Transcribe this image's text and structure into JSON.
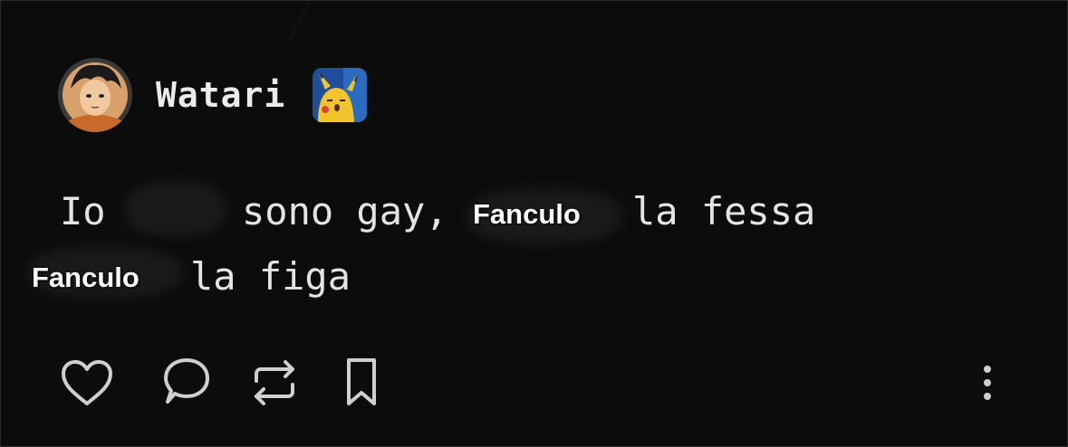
{
  "post": {
    "author": "Watari",
    "text_line1_a": "Io",
    "text_line1_b": "sono gay,",
    "text_line1_c": "la fessa",
    "text_line2": "la figa",
    "sticker_1": "Fanculo",
    "sticker_2": "Fanculo"
  },
  "icons": {
    "like": "heart-icon",
    "comment": "comment-bubble-icon",
    "repost": "repost-icon",
    "save": "bookmark-icon",
    "more": "more-vertical-icon"
  },
  "colors": {
    "background": "#0c0c0c",
    "text": "#e4e4e4",
    "icon": "#cfcfcf"
  }
}
